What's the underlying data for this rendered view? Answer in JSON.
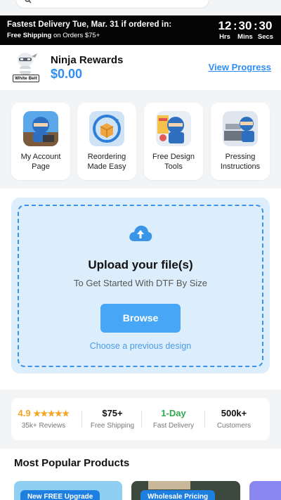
{
  "search": {
    "icon": "search-icon"
  },
  "banner": {
    "headline": "Fastest Delivery Tue, Mar. 31 if ordered in:",
    "free_prefix": "Free Shipping",
    "free_suffix": " on Orders $75+",
    "hours": "12",
    "minutes": "30",
    "seconds": "30",
    "hours_label": "Hrs",
    "minutes_label": "Mins",
    "seconds_label": "Secs"
  },
  "rewards": {
    "belt_label": "White Belt",
    "title": "Ninja Rewards",
    "amount": "$0.00",
    "link": "View Progress"
  },
  "tiles": [
    {
      "label": "My Account Page",
      "icon": "account-ninja-icon"
    },
    {
      "label": "Reordering Made Easy",
      "icon": "reorder-box-icon"
    },
    {
      "label": "Free Design Tools",
      "icon": "design-ninja-icon"
    },
    {
      "label": "Pressing Instructions",
      "icon": "heat-press-ninja-icon"
    }
  ],
  "upload": {
    "title": "Upload your file(s)",
    "subtitle": "To Get Started With DTF By Size",
    "button": "Browse",
    "previous_link": "Choose a previous design"
  },
  "stats": {
    "rating": "4.9",
    "stars": "★★★★★",
    "reviews": "35k+ Reviews",
    "shipping_value": "$75+",
    "shipping_caption": "Free Shipping",
    "delivery_value": "1-Day",
    "delivery_caption": "Fast Delivery",
    "customers_value": "500k+",
    "customers_caption": "Customers"
  },
  "popular": {
    "title": "Most Popular Products",
    "cards": [
      {
        "tag": "New FREE Upgrade"
      },
      {
        "tag": "Wholesale Pricing"
      }
    ]
  },
  "colors": {
    "accent_blue": "#2f8ef5",
    "banner_bg": "#050505",
    "star_orange": "#f2a623",
    "delivery_green": "#2fa84f"
  }
}
